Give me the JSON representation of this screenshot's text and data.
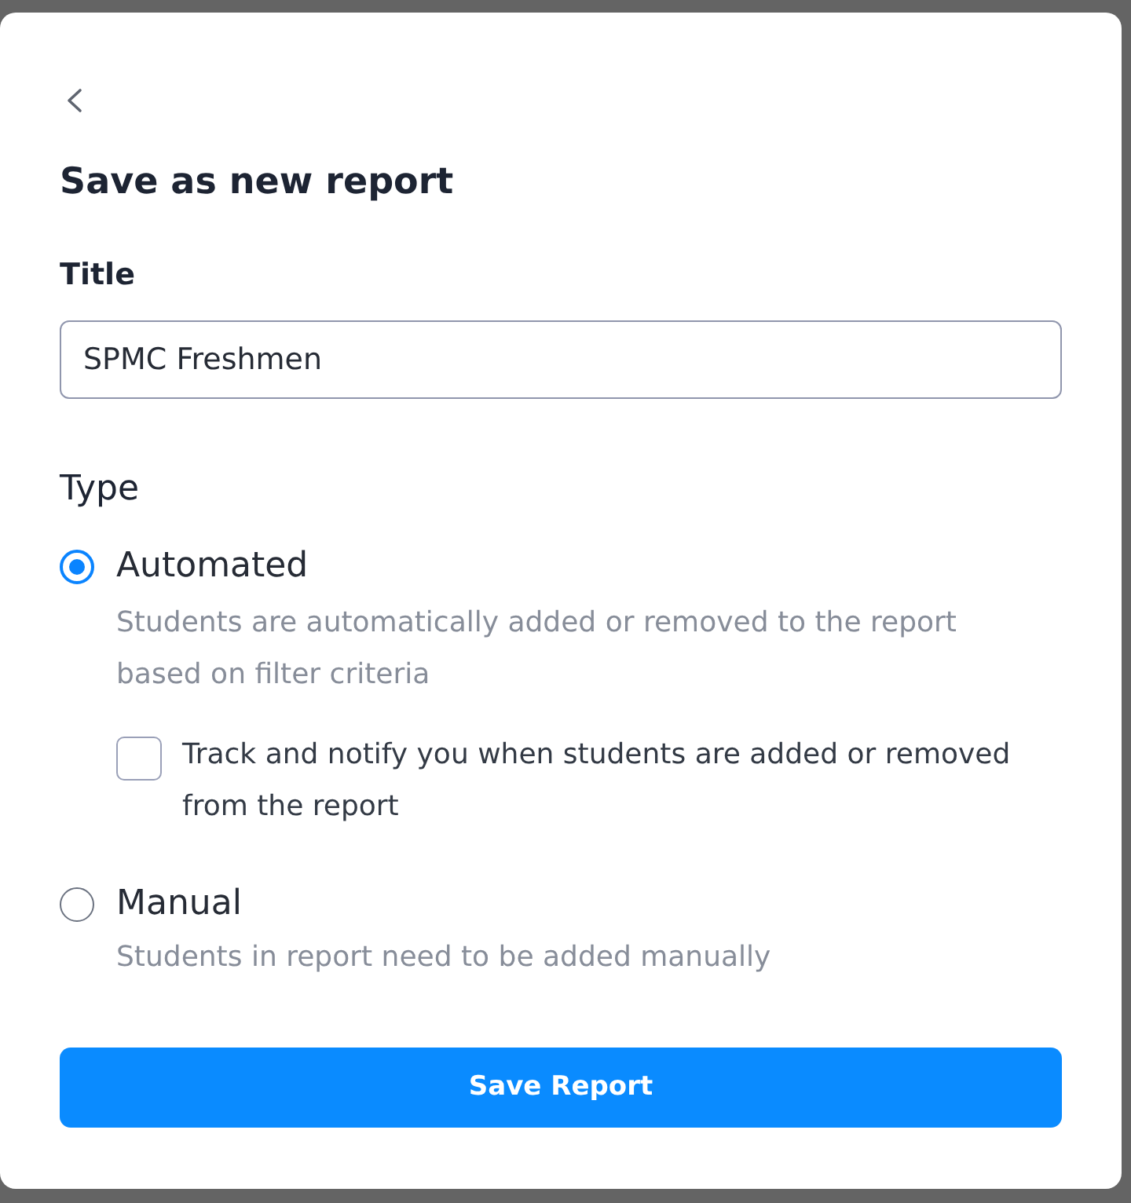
{
  "dialog": {
    "title": "Save as new report"
  },
  "title_field": {
    "label": "Title",
    "value": "SPMC Freshmen"
  },
  "type_group": {
    "label": "Type",
    "options": [
      {
        "label": "Automated",
        "description": "Students are automatically added or removed to the report based on filter criteria",
        "selected": true,
        "suboption": {
          "label": "Track and notify you when students are added or removed from the report",
          "checked": false
        }
      },
      {
        "label": "Manual",
        "description": "Students in report need to be added manually",
        "selected": false
      }
    ]
  },
  "buttons": [
    {
      "label": "Save Report"
    }
  ]
}
